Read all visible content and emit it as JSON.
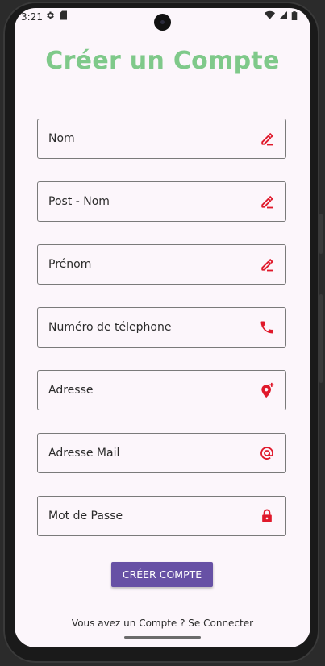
{
  "status_bar": {
    "time": "3:21",
    "left_icons": [
      "gear-icon",
      "sd-card-icon"
    ],
    "right_icons": [
      "wifi-icon",
      "signal-icon",
      "battery-icon"
    ]
  },
  "page": {
    "title": "Créer un Compte"
  },
  "form": {
    "fields": [
      {
        "label": "Nom",
        "icon": "edit-icon"
      },
      {
        "label": "Post - Nom",
        "icon": "edit-icon"
      },
      {
        "label": "Prénom",
        "icon": "edit-icon"
      },
      {
        "label": "Numéro de télephone",
        "icon": "phone-icon"
      },
      {
        "label": "Adresse",
        "icon": "add-location-icon"
      },
      {
        "label": "Adresse Mail",
        "icon": "at-icon"
      },
      {
        "label": "Mot de Passe",
        "icon": "lock-icon"
      }
    ],
    "submit_label": "CRÉER COMPTE",
    "login_link": "Vous avez un Compte ? Se Connecter"
  },
  "colors": {
    "title": "#7fc98a",
    "icon": "#e0192b",
    "button": "#6751a5",
    "background": "#fcf6fb"
  }
}
